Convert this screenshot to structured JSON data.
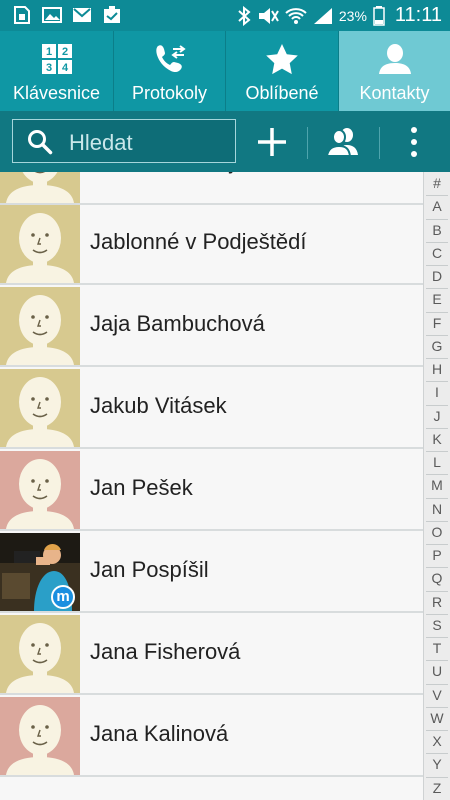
{
  "status_bar": {
    "battery_percent": "23%",
    "time": "11:11",
    "left_icons": [
      "sim-card-icon",
      "gallery-icon",
      "gmail-icon",
      "clipboard-icon"
    ],
    "right_icons": [
      "bluetooth-icon",
      "mute-icon",
      "wifi-icon",
      "signal-icon",
      "battery-icon"
    ]
  },
  "tabs": [
    {
      "label": "Klávesnice",
      "icon": "keypad-icon",
      "active": false
    },
    {
      "label": "Protokoly",
      "icon": "call-log-icon",
      "active": false
    },
    {
      "label": "Oblíbené",
      "icon": "star-icon",
      "active": false
    },
    {
      "label": "Kontakty",
      "icon": "person-icon",
      "active": true
    }
  ],
  "toolbar": {
    "search_placeholder": "Hledat",
    "add_icon": "plus-icon",
    "groups_icon": "groups-icon",
    "menu_icon": "overflow-menu-icon"
  },
  "contacts": [
    {
      "name": "Jabloné v Podj",
      "avatar": "default",
      "avatar_color": "#d7c98f"
    },
    {
      "name": "Jablonné v Podještědí",
      "avatar": "default",
      "avatar_color": "#d7c98f"
    },
    {
      "name": "Jaja Bambuchová",
      "avatar": "default",
      "avatar_color": "#d7c98f"
    },
    {
      "name": "Jakub Vitásek",
      "avatar": "default",
      "avatar_color": "#d7c98f"
    },
    {
      "name": "Jan Pešek",
      "avatar": "default",
      "avatar_color": "#dba89d"
    },
    {
      "name": "Jan Pospíšil",
      "avatar": "photo",
      "avatar_color": "#3a3020",
      "badge": "m"
    },
    {
      "name": "Jana Fisherová",
      "avatar": "default",
      "avatar_color": "#d7c98f"
    },
    {
      "name": "Jana Kalinová",
      "avatar": "default",
      "avatar_color": "#dba89d"
    }
  ],
  "alphabet_index": [
    "#",
    "A",
    "B",
    "C",
    "D",
    "E",
    "F",
    "G",
    "H",
    "I",
    "J",
    "K",
    "L",
    "M",
    "N",
    "O",
    "P",
    "Q",
    "R",
    "S",
    "T",
    "U",
    "V",
    "W",
    "X",
    "Y",
    "Z"
  ],
  "colors": {
    "status_bar": "#0d8a96",
    "tab_bar": "#0f97a4",
    "tab_active": "#6fc9d3",
    "toolbar": "#117882",
    "face": "#f8f3e2"
  }
}
